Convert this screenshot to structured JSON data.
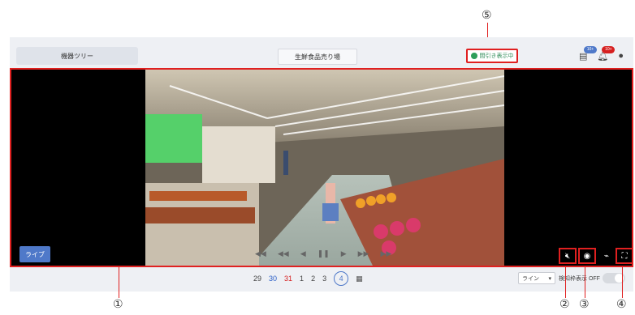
{
  "topbar": {
    "tree_label": "機器ツリー",
    "location_label": "生鮮食品売り場",
    "thinned_label": "間引き表示中",
    "notif_badge": "10+",
    "alert_badge": "10+"
  },
  "player": {
    "live_label": "ライブ"
  },
  "dates": {
    "items": [
      "29",
      "30",
      "31",
      "1",
      "2",
      "3",
      "4"
    ],
    "selected": "4"
  },
  "bottom": {
    "line_select": "ライン",
    "frame_label": "検知枠表示 OFF"
  },
  "callouts": {
    "c1": "①",
    "c2": "②",
    "c3": "③",
    "c4": "④",
    "c5": "⑤"
  },
  "colors": {
    "accent": "#4f79c9",
    "highlight": "#e02020",
    "green": "#2e9e5a"
  }
}
